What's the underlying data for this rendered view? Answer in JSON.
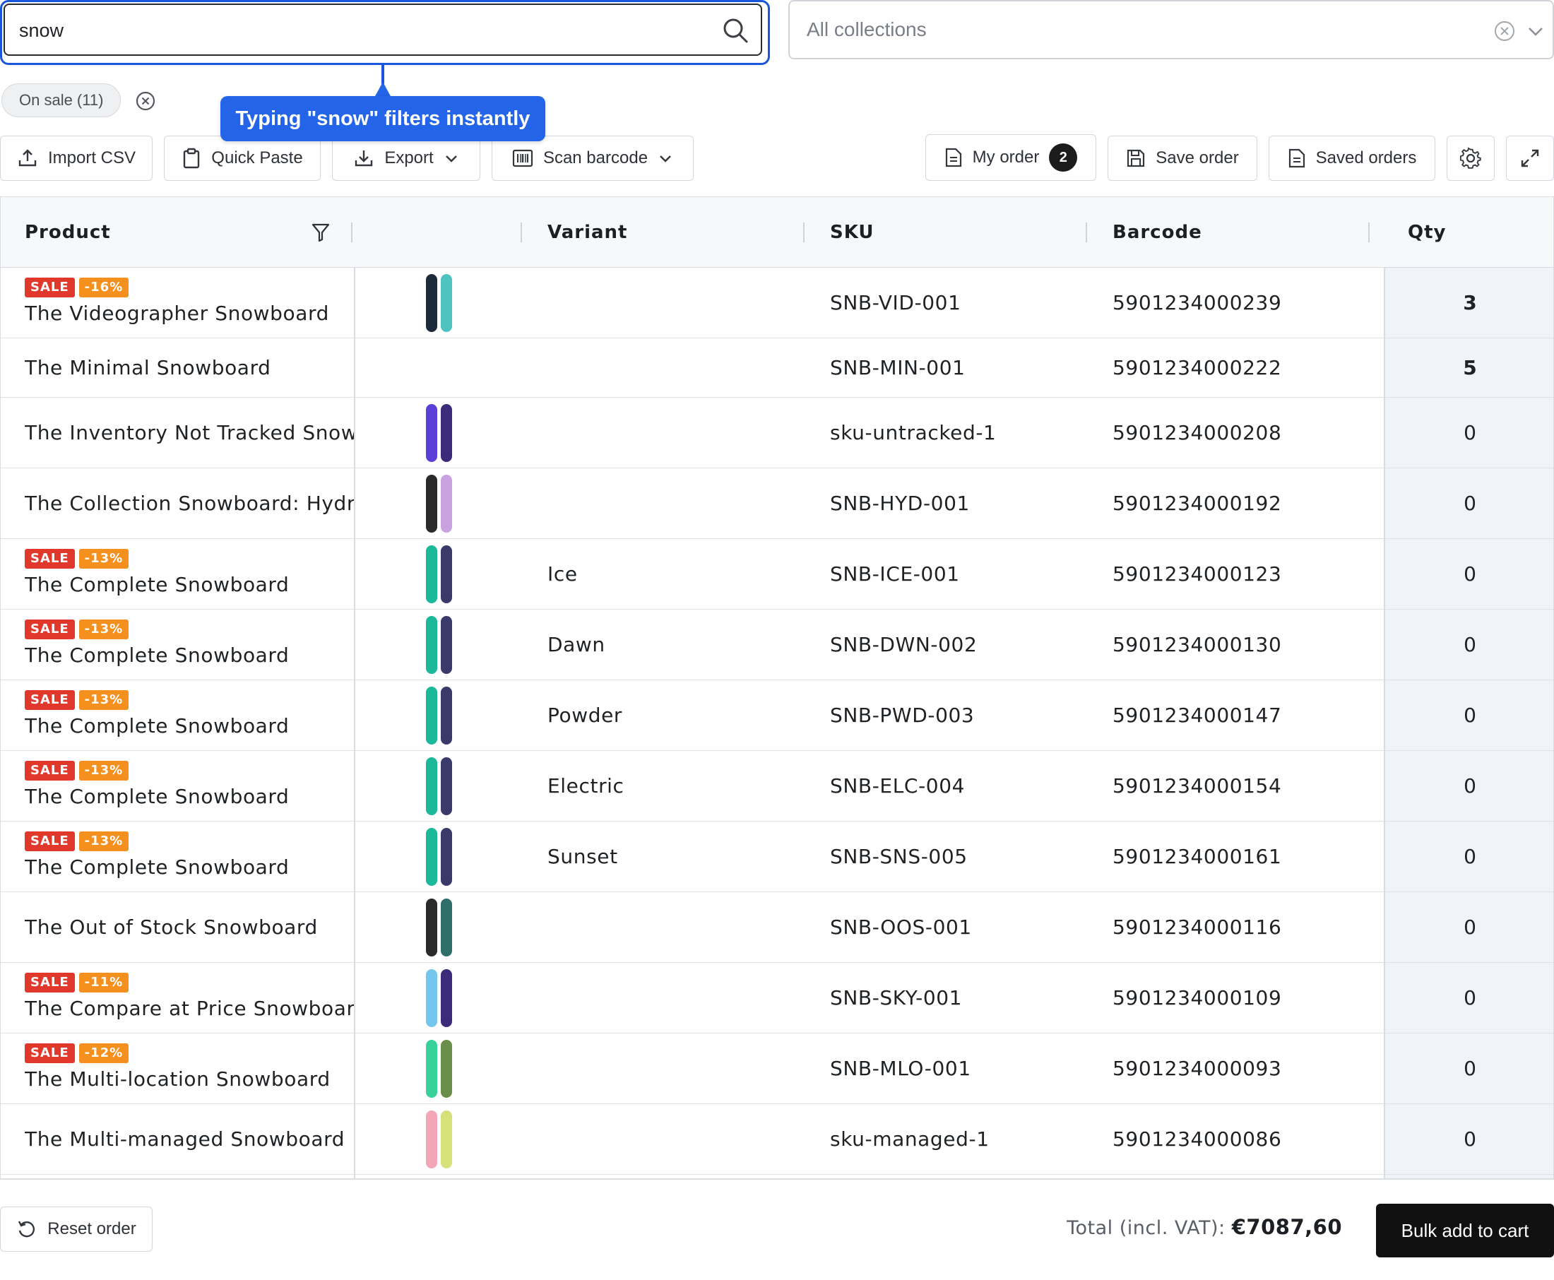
{
  "search": {
    "value": "snow"
  },
  "collections": {
    "placeholder": "All collections"
  },
  "filters": {
    "chip_label": "On sale (11)"
  },
  "tooltip": {
    "text": "Typing \"snow\" filters instantly"
  },
  "toolbar": {
    "import_csv": "Import CSV",
    "quick_paste": "Quick Paste",
    "export": "Export",
    "scan_barcode": "Scan barcode",
    "my_order": "My order",
    "my_order_count": "2",
    "save_order": "Save order",
    "saved_orders": "Saved orders"
  },
  "table": {
    "columns": {
      "product": "Product",
      "variant": "Variant",
      "sku": "SKU",
      "barcode": "Barcode",
      "qty": "Qty"
    },
    "rows": [
      {
        "sale": "SALE",
        "discount": "-16%",
        "product": "The Videographer Snowboard",
        "variant": "",
        "sku": "SNB-VID-001",
        "barcode": "5901234000239",
        "qty": "3"
      },
      {
        "sale": "",
        "discount": "",
        "product": "The Minimal Snowboard",
        "variant": "",
        "sku": "SNB-MIN-001",
        "barcode": "5901234000222",
        "qty": "5"
      },
      {
        "sale": "",
        "discount": "",
        "product": "The Inventory Not Tracked Snowb",
        "variant": "",
        "sku": "sku-untracked-1",
        "barcode": "5901234000208",
        "qty": "0"
      },
      {
        "sale": "",
        "discount": "",
        "product": "The Collection Snowboard: Hydro",
        "variant": "",
        "sku": "SNB-HYD-001",
        "barcode": "5901234000192",
        "qty": "0"
      },
      {
        "sale": "SALE",
        "discount": "-13%",
        "product": "The Complete Snowboard",
        "variant": "Ice",
        "sku": "SNB-ICE-001",
        "barcode": "5901234000123",
        "qty": "0"
      },
      {
        "sale": "SALE",
        "discount": "-13%",
        "product": "The Complete Snowboard",
        "variant": "Dawn",
        "sku": "SNB-DWN-002",
        "barcode": "5901234000130",
        "qty": "0"
      },
      {
        "sale": "SALE",
        "discount": "-13%",
        "product": "The Complete Snowboard",
        "variant": "Powder",
        "sku": "SNB-PWD-003",
        "barcode": "5901234000147",
        "qty": "0"
      },
      {
        "sale": "SALE",
        "discount": "-13%",
        "product": "The Complete Snowboard",
        "variant": "Electric",
        "sku": "SNB-ELC-004",
        "barcode": "5901234000154",
        "qty": "0"
      },
      {
        "sale": "SALE",
        "discount": "-13%",
        "product": "The Complete Snowboard",
        "variant": "Sunset",
        "sku": "SNB-SNS-005",
        "barcode": "5901234000161",
        "qty": "0"
      },
      {
        "sale": "",
        "discount": "",
        "product": "The Out of Stock Snowboard",
        "variant": "",
        "sku": "SNB-OOS-001",
        "barcode": "5901234000116",
        "qty": "0"
      },
      {
        "sale": "SALE",
        "discount": "-11%",
        "product": "The Compare at Price Snowboard",
        "variant": "",
        "sku": "SNB-SKY-001",
        "barcode": "5901234000109",
        "qty": "0"
      },
      {
        "sale": "SALE",
        "discount": "-12%",
        "product": "The Multi-location Snowboard",
        "variant": "",
        "sku": "SNB-MLO-001",
        "barcode": "5901234000093",
        "qty": "0"
      },
      {
        "sale": "",
        "discount": "",
        "product": "The Multi-managed Snowboard",
        "variant": "",
        "sku": "sku-managed-1",
        "barcode": "5901234000086",
        "qty": "0"
      }
    ]
  },
  "footer": {
    "reset_order": "Reset order",
    "total_label": "Total (incl. VAT):",
    "total_value": "€7087,60",
    "bulk_add": "Bulk add to cart"
  },
  "colors": {
    "accent": "#2464e8",
    "sale": "#e0392b",
    "discount": "#f5901e",
    "primary_button": "#111111"
  },
  "icons": [
    "search-icon",
    "clear-icon",
    "chevron-down-icon",
    "upload-icon",
    "clipboard-icon",
    "download-icon",
    "barcode-icon",
    "document-icon",
    "save-icon",
    "gear-icon",
    "expand-icon",
    "filter-icon",
    "reset-icon"
  ]
}
